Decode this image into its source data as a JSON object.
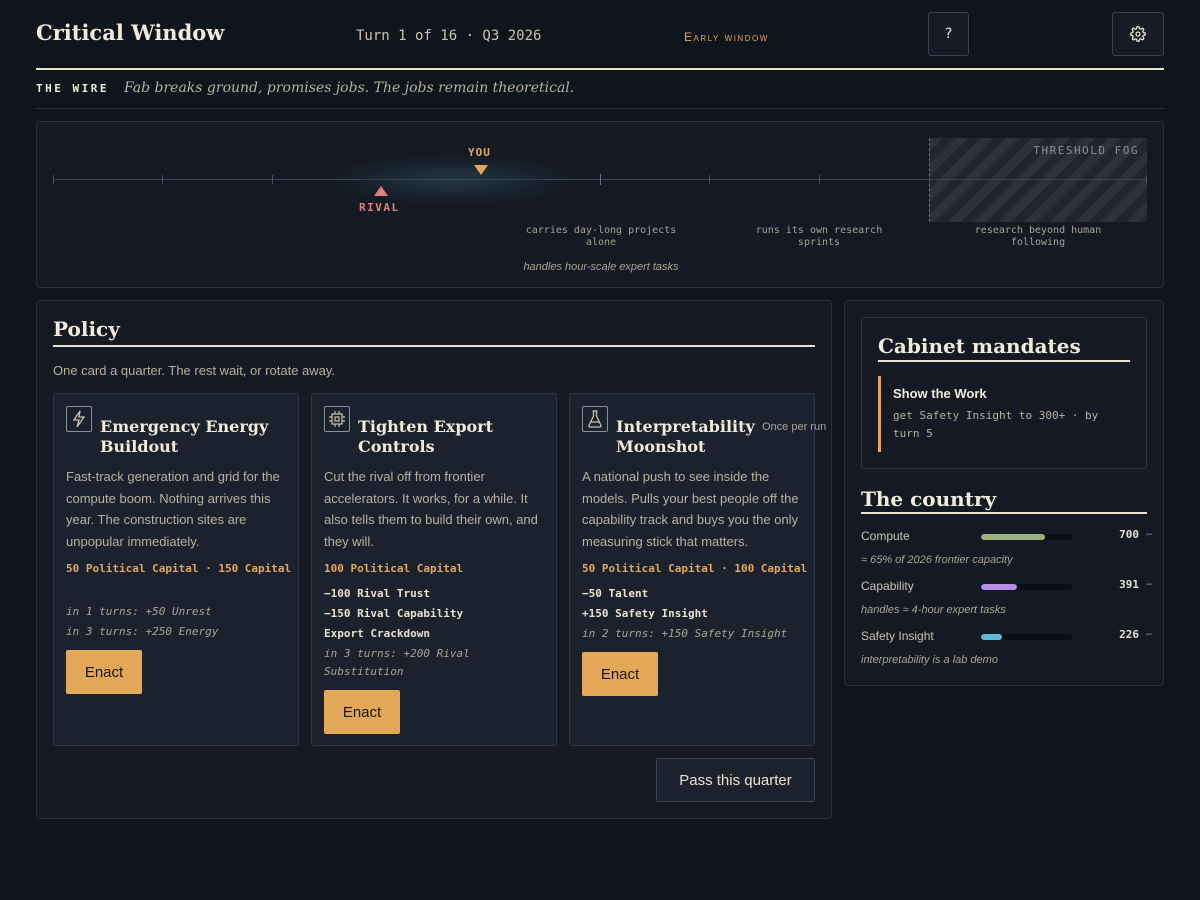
{
  "header": {
    "title": "Critical Window",
    "turn": "Turn 1 of 16 · Q3 2026",
    "window": "Early window",
    "help_label": "?"
  },
  "wire": {
    "label": "THE WIRE",
    "headline": "Fab breaks ground, promises jobs. The jobs remain theoretical."
  },
  "track": {
    "fog_label": "THRESHOLD FOG",
    "you_label": "YOU",
    "rival_label": "RIVAL",
    "milestones": [
      "carries day-long projects alone",
      "runs its own research sprints",
      "research beyond human following"
    ],
    "note": "handles hour-scale expert tasks"
  },
  "policy": {
    "title": "Policy",
    "subtitle": "One card a quarter. The rest wait, or rotate away.",
    "pass_label": "Pass this quarter",
    "cards": [
      {
        "icon": "lightning-icon",
        "title": "Emergency Energy Buildout",
        "tag": "",
        "description": "Fast-track generation and grid for the compute boom. Nothing arrives this year. The construction sites are unpopular immediately.",
        "cost": "50 Political Capital · 150 Capital",
        "effects": [],
        "delayed": [
          "in 1 turns: +50 Unrest",
          "in 3 turns: +250 Energy"
        ],
        "enact_label": "Enact"
      },
      {
        "icon": "chip-icon",
        "title": "Tighten Export Controls",
        "tag": "",
        "description": "Cut the rival off from frontier accelerators. It works, for a while. It also tells them to build their own, and they will.",
        "cost": "100 Political Capital",
        "effects": [
          "−100 Rival Trust",
          "−150 Rival Capability",
          "Export Crackdown"
        ],
        "delayed": [
          "in 3 turns: +200 Rival Substitution"
        ],
        "enact_label": "Enact"
      },
      {
        "icon": "flask-icon",
        "title": "Interpretability Moonshot",
        "tag": "Once per run",
        "description": "A national push to see inside the models. Pulls your best people off the capability track and buys you the only measuring stick that matters.",
        "cost": "50 Political Capital · 100 Capital",
        "effects": [
          "−50 Talent",
          "+150 Safety Insight"
        ],
        "delayed": [
          "in 2 turns: +150 Safety Insight"
        ],
        "enact_label": "Enact"
      }
    ]
  },
  "mandates": {
    "title": "Cabinet mandates",
    "items": [
      {
        "name": "Show the Work",
        "description": "get Safety Insight to 300+ · by turn 5"
      }
    ]
  },
  "country": {
    "title": "The country",
    "stats": [
      {
        "label": "Compute",
        "value": "700",
        "trend": "–",
        "fill": 0.7,
        "color": "#9bb07f",
        "note": "≈ 65% of 2026 frontier capacity"
      },
      {
        "label": "Capability",
        "value": "391",
        "trend": "–",
        "fill": 0.39,
        "color": "#b58ee6",
        "note": "handles ≈ 4-hour expert tasks"
      },
      {
        "label": "Safety Insight",
        "value": "226",
        "trend": "–",
        "fill": 0.23,
        "color": "#5bbdd6",
        "note": "interpretability is a lab demo"
      }
    ]
  }
}
